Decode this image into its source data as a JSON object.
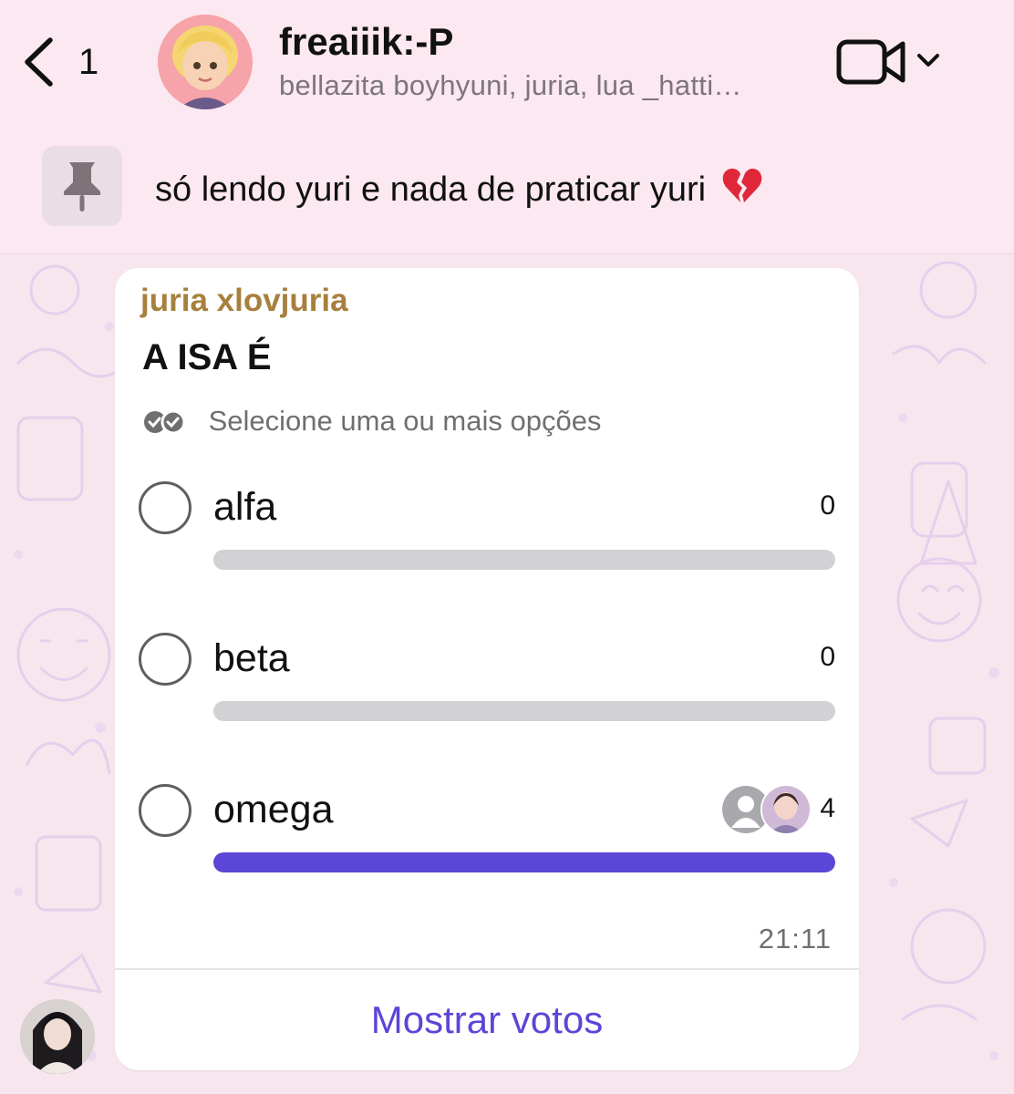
{
  "header": {
    "back_count": "1",
    "title": "freaiiik:-P",
    "members": "bellazita boyhyuni, juria, lua _hatti…",
    "icons": {
      "back": "chevron-left-icon",
      "call": "video-camera-icon",
      "menu": "chevron-down-icon"
    }
  },
  "pinned": {
    "text": "só lendo yuri e nada de praticar yuri",
    "emoji": "broken-heart",
    "icon": "pin-icon"
  },
  "poll": {
    "sender": "juria xlovjuria",
    "question": "A ISA É",
    "hint": "Selecione uma ou mais opções",
    "options": [
      {
        "label": "alfa",
        "count": "0",
        "share": 0
      },
      {
        "label": "beta",
        "count": "0",
        "share": 0
      },
      {
        "label": "omega",
        "count": "4",
        "share": 1
      }
    ],
    "time": "21:11",
    "show_votes": "Mostrar votos"
  },
  "colors": {
    "accent": "#5b46d8",
    "sender_name": "#a7803d",
    "header_bg": "#fbe8f0",
    "wallpaper": "#f7e6ee",
    "wallpaper_doodles": "#e9d3ee"
  }
}
